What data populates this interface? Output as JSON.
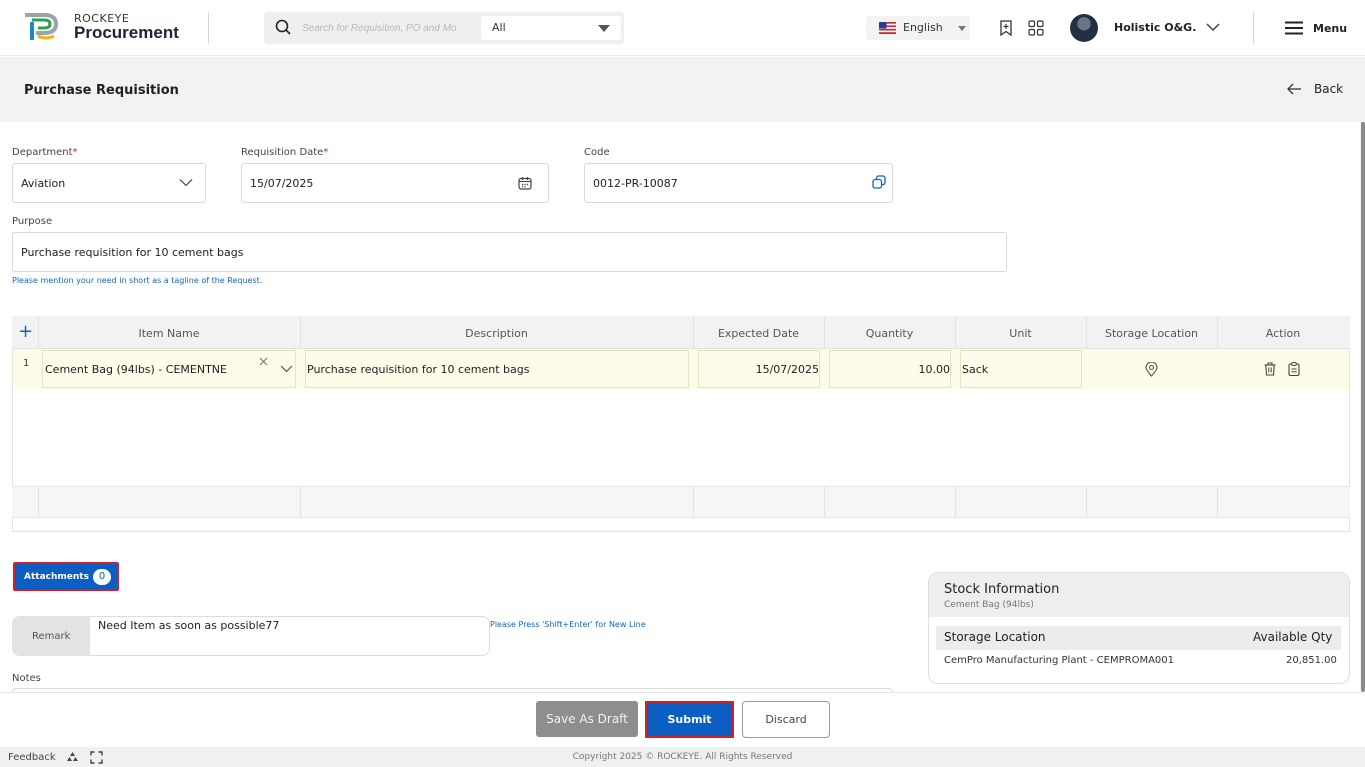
{
  "header": {
    "brand_small": "ROCKEYE",
    "brand_big": "Procurement",
    "search_placeholder": "Search for Requisition, PO and Mo",
    "search_filter": "All",
    "language": "English",
    "user_name": "Holistic O&G.",
    "menu_label": "Menu"
  },
  "page": {
    "title": "Purchase Requisition",
    "back_label": "Back"
  },
  "form": {
    "department_label": "Department",
    "department_value": "Aviation",
    "req_date_label": "Requisition Date",
    "req_date_value": "15/07/2025",
    "code_label": "Code",
    "code_value": "0012-PR-10087",
    "purpose_label": "Purpose",
    "purpose_value": "Purchase requisition for 10 cement bags",
    "purpose_hint": "Please mention your need in short as a tagline of the Request.",
    "required_mark": "*"
  },
  "grid": {
    "add_icon_text": "+",
    "columns": [
      "Item Name",
      "Description",
      "Expected Date",
      "Quantity",
      "Unit",
      "Storage Location",
      "Action"
    ],
    "rows": [
      {
        "index": "1",
        "item_name": "Cement Bag (94lbs) - CEMENTNE",
        "description": "Purchase requisition for 10 cement bags",
        "expected_date": "15/07/2025",
        "quantity": "10.00",
        "unit": "Sack"
      }
    ]
  },
  "attachments": {
    "label": "Attachments",
    "count": "0"
  },
  "remark": {
    "label": "Remark",
    "value": "Need Item as soon as possible77",
    "hint": "Please Press 'Shift+Enter' for New Line"
  },
  "notes": {
    "label": "Notes"
  },
  "stock": {
    "title": "Stock Information",
    "subtitle": "Cement Bag (94lbs)",
    "col_location": "Storage Location",
    "col_qty": "Available Qty",
    "rows": [
      {
        "location": "CemPro Manufacturing Plant - CEMPROMA001",
        "qty": "20,851.00"
      }
    ]
  },
  "actions": {
    "save_draft": "Save As Draft",
    "submit": "Submit",
    "discard": "Discard"
  },
  "footer": {
    "feedback": "Feedback",
    "copyright": "Copyright 2025 © ROCKEYE. All Rights Reserved"
  },
  "colors": {
    "primary": "#0b5fc2",
    "highlight_border": "#d31f26",
    "row_fill": "#fdfbea"
  }
}
